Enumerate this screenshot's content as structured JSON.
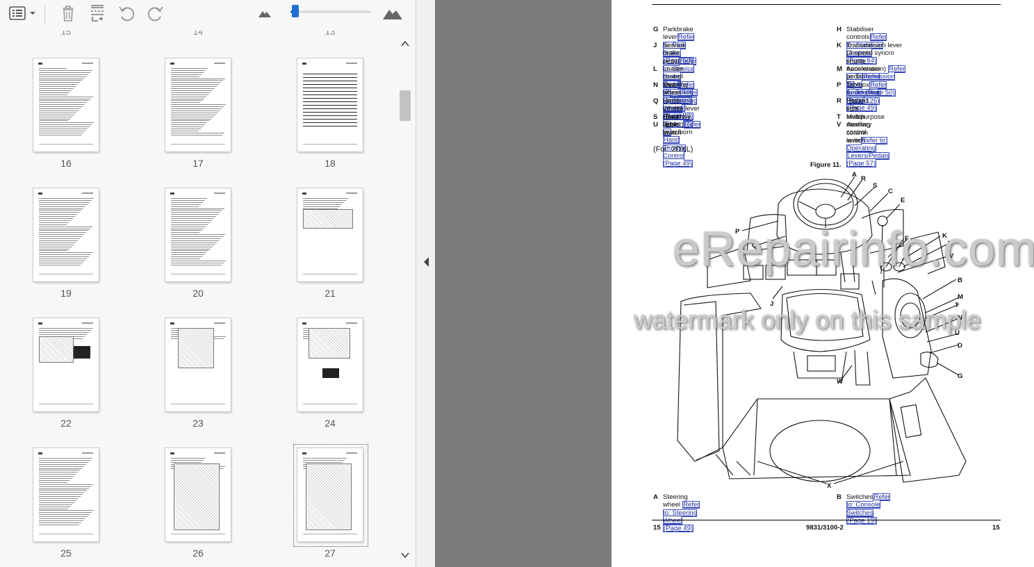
{
  "toolbar": {
    "icons": [
      "list-view-icon",
      "chevron-down-icon",
      "trash-icon",
      "extract-pages-icon",
      "rotate-left-icon",
      "rotate-right-icon",
      "zoom-out-mountain-icon",
      "zoom-in-mountain-icon"
    ],
    "zoom_level_fraction": 0.05,
    "accent_color": "#1e6fd0"
  },
  "thumbnails": {
    "top_partial_numbers": [
      "15",
      "14",
      "13"
    ],
    "pages": [
      "16",
      "17",
      "18",
      "19",
      "20",
      "21",
      "22",
      "23",
      "24",
      "25",
      "26",
      "27"
    ],
    "selected_page": "27"
  },
  "document": {
    "legend_top_left": [
      {
        "letter": "G",
        "text": "Parkbrake lever",
        "link": "Refer to: Park Brake",
        "page": "(Page 50)"
      },
      {
        "letter": "J",
        "text": "Service brake pedal",
        "link": "Refer to: Service Brake",
        "page": "Pedal (Page 49)"
      },
      {
        "letter": "L",
        "text": "Loader control lever",
        "link": "Refer to: Operating Levers/",
        "page": "Pedals (Page 57)"
      },
      {
        "letter": "N",
        "text": "Steering wheel",
        "link": "Refer to: Steering Wheel",
        "page": "(Page 49)"
      },
      {
        "letter": "Q",
        "text": "Hand throttle lever (Backhoe loader)",
        "link": "Refer to:",
        "page": "Hand Throttle Control (Page 49)"
      },
      {
        "letter": "S",
        "text": "Head light switch",
        "link": "",
        "page": ""
      },
      {
        "letter": "U",
        "text": "Drive lever/horn",
        "link": "",
        "page": ""
      }
    ],
    "legend_top_right": [
      {
        "letter": "H",
        "text": "Stabiliser controls",
        "link": "Refer to: Stabiliser Controls",
        "extra": "",
        "page": "(Page 64)"
      },
      {
        "letter": "K",
        "text": "Transmission lever (4-speed syncro shuttle",
        "extra": "transmission)",
        "link": "Refer to: Transmission Drive",
        "page": "Lever (Page 50)"
      },
      {
        "letter": "M",
        "text": "Accelerator pedal",
        "link": "Refer to: Accelerator Pedal",
        "extra": "",
        "page": "(Page 49)"
      },
      {
        "letter": "P",
        "text": "Toolbox",
        "link": "Refer to: Toolbox (Page 126)",
        "extra": "",
        "page": ""
      },
      {
        "letter": "R",
        "text": "Hazard light switch",
        "link": "",
        "extra": "",
        "page": ""
      },
      {
        "letter": "T",
        "text": "Multipurpose steering column switch",
        "link": "",
        "extra": "",
        "page": ""
      },
      {
        "letter": "V",
        "text": "Auxiliary control lever",
        "link": "Refer to: Operating",
        "extra": "",
        "page": "Levers/Pedals (Page 57)"
      }
    ],
    "for_text": "(For: 2DXL)",
    "figure_title": "Figure 11.",
    "callouts": [
      "A",
      "R",
      "S",
      "C",
      "E",
      "P",
      "Q",
      "F",
      "K",
      "L",
      "V",
      "B",
      "M",
      "T",
      "N",
      "U",
      "D",
      "G",
      "J",
      "W",
      "X"
    ],
    "legend_bottom": [
      {
        "letter": "A",
        "text": "Steering wheel",
        "link": "Refer to: Steering Wheel",
        "page": "(Page 49)"
      },
      {
        "letter": "B",
        "text": "Switches",
        "link": "Refer to: Console Switches",
        "page": "(Page 19)"
      }
    ],
    "footer_left": "15",
    "footer_center": "9831/3100-2",
    "footer_right": "15"
  },
  "watermark": {
    "line1": "eRepairinfo.com",
    "line2": "watermark only on this sample"
  }
}
